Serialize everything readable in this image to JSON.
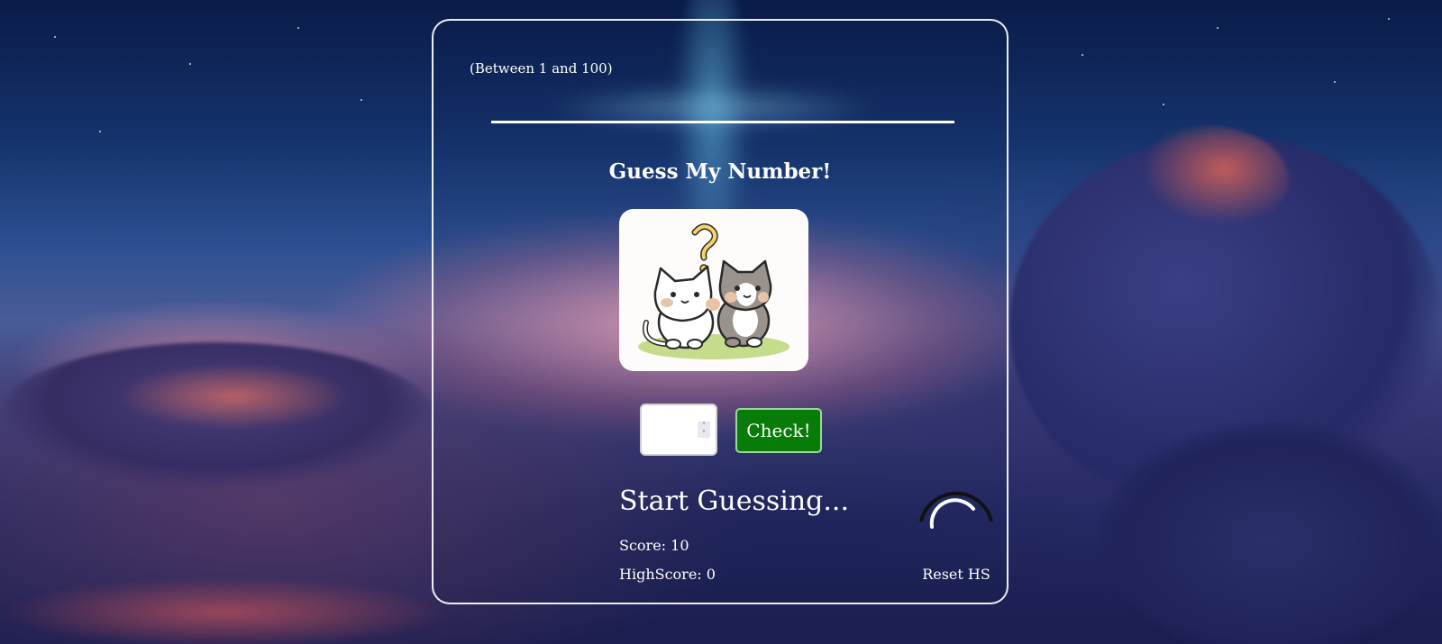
{
  "game": {
    "range_hint": "(Between 1 and 100)",
    "title": "Guess My Number!",
    "picture_icon": "two-cats-question-icon",
    "guess_input": {
      "value": "",
      "placeholder": ""
    },
    "check_label": "Check!",
    "message": "Start Guessing...",
    "score_label": "Score: 10",
    "highscore_label": "HighScore: 0",
    "reset_label": "Reset HS",
    "reset_icon": "refresh-icon"
  },
  "colors": {
    "check_button": "#087c08",
    "card_border": "#ffffff",
    "text": "#ffffff"
  }
}
